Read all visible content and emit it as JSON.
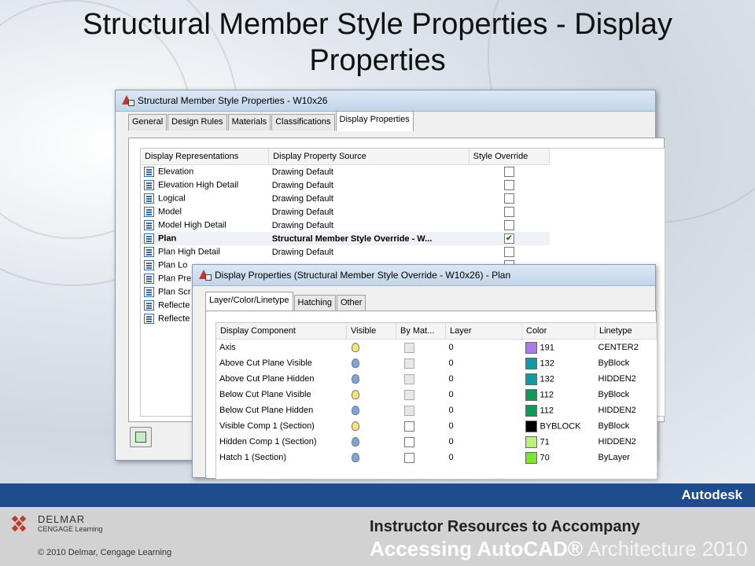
{
  "slide": {
    "title_line1": "Structural Member Style Properties - Display",
    "title_line2": "Properties"
  },
  "main_window": {
    "title": "Structural Member Style Properties - W10x26",
    "tabs": [
      "General",
      "Design Rules",
      "Materials",
      "Classifications",
      "Display Properties"
    ],
    "active_tab": "Display Properties",
    "columns": [
      "Display Representations",
      "Display Property Source",
      "Style Override"
    ],
    "rows": [
      {
        "name": "Elevation",
        "source": "Drawing Default",
        "override": false
      },
      {
        "name": "Elevation High Detail",
        "source": "Drawing Default",
        "override": false
      },
      {
        "name": "Logical",
        "source": "Drawing Default",
        "override": false
      },
      {
        "name": "Model",
        "source": "Drawing Default",
        "override": false
      },
      {
        "name": "Model High Detail",
        "source": "Drawing Default",
        "override": false
      },
      {
        "name": "Plan",
        "source": "Structural Member Style Override - W...",
        "override": true,
        "selected": true
      },
      {
        "name": "Plan High Detail",
        "source": "Drawing Default",
        "override": false
      },
      {
        "name": "Plan Lo",
        "source": "",
        "override": false
      },
      {
        "name": "Plan Pre",
        "source": "",
        "override": false
      },
      {
        "name": "Plan Scr",
        "source": "",
        "override": false
      },
      {
        "name": "Reflecte",
        "source": "",
        "override": false
      },
      {
        "name": "Reflecte",
        "source": "",
        "override": false
      }
    ]
  },
  "display_window": {
    "title": "Display Properties (Structural Member Style Override - W10x26) - Plan",
    "tabs": [
      "Layer/Color/Linetype",
      "Hatching",
      "Other"
    ],
    "active_tab": "Layer/Color/Linetype",
    "columns": [
      "Display Component",
      "Visible",
      "By Mat...",
      "Layer",
      "Color",
      "Linetype"
    ],
    "rows": [
      {
        "component": "Axis",
        "visible": "on",
        "by_mat_enabled": false,
        "layer": "0",
        "color_label": "191",
        "color_hex": "#b07ae6",
        "linetype": "CENTER2"
      },
      {
        "component": "Above Cut Plane Visible",
        "visible": "off",
        "by_mat_enabled": false,
        "layer": "0",
        "color_label": "132",
        "color_hex": "#0f9aa6",
        "linetype": "ByBlock"
      },
      {
        "component": "Above Cut Plane Hidden",
        "visible": "off",
        "by_mat_enabled": false,
        "layer": "0",
        "color_label": "132",
        "color_hex": "#0f9aa6",
        "linetype": "HIDDEN2"
      },
      {
        "component": "Below Cut Plane Visible",
        "visible": "on",
        "by_mat_enabled": false,
        "layer": "0",
        "color_label": "112",
        "color_hex": "#0f9a5a",
        "linetype": "ByBlock"
      },
      {
        "component": "Below Cut Plane Hidden",
        "visible": "off",
        "by_mat_enabled": false,
        "layer": "0",
        "color_label": "112",
        "color_hex": "#0f9a5a",
        "linetype": "HIDDEN2"
      },
      {
        "component": "Visible Comp 1 (Section)",
        "visible": "on",
        "by_mat_enabled": true,
        "layer": "0",
        "color_label": "BYBLOCK",
        "color_hex": "#000000",
        "linetype": "ByBlock"
      },
      {
        "component": "Hidden Comp 1 (Section)",
        "visible": "off",
        "by_mat_enabled": true,
        "layer": "0",
        "color_label": "71",
        "color_hex": "#b8f27a",
        "linetype": "HIDDEN2"
      },
      {
        "component": "Hatch 1 (Section)",
        "visible": "off",
        "by_mat_enabled": true,
        "layer": "0",
        "color_label": "70",
        "color_hex": "#7ee62a",
        "linetype": "ByLayer"
      }
    ]
  },
  "footer": {
    "brand": "Autodesk",
    "publisher": "DELMAR",
    "publisher_sub": "CENGAGE Learning",
    "copyright": "© 2010  Delmar, Cengage Learning",
    "resources_line1": "Instructor Resources to Accompany",
    "resources_line2_bold": "Accessing AutoCAD®",
    "resources_line2_light": " Architecture 2010"
  }
}
